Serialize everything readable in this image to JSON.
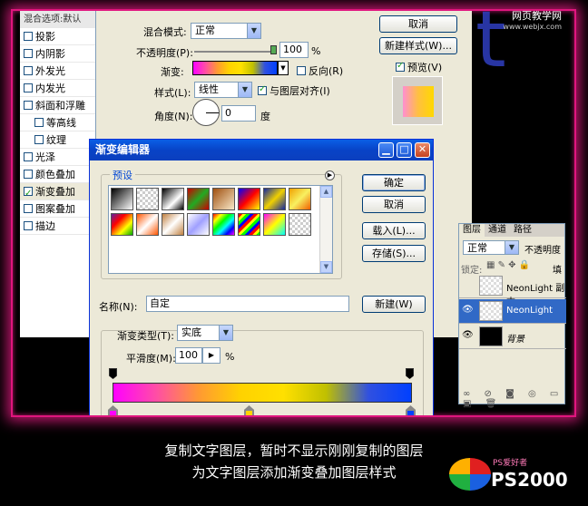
{
  "watermark": {
    "site": "网页教学网",
    "url": "www.webjx.com"
  },
  "style_list": {
    "header": "混合选项:默认",
    "items": [
      {
        "label": "投影",
        "checked": false
      },
      {
        "label": "内阴影",
        "checked": false
      },
      {
        "label": "外发光",
        "checked": false
      },
      {
        "label": "内发光",
        "checked": false
      },
      {
        "label": "斜面和浮雕",
        "checked": false
      },
      {
        "label": "等高线",
        "checked": false,
        "indent": true
      },
      {
        "label": "纹理",
        "checked": false,
        "indent": true
      },
      {
        "label": "光泽",
        "checked": false
      },
      {
        "label": "颜色叠加",
        "checked": false
      },
      {
        "label": "渐变叠加",
        "checked": true,
        "selected": true
      },
      {
        "label": "图案叠加",
        "checked": false
      },
      {
        "label": "描边",
        "checked": false
      }
    ]
  },
  "gradient_overlay": {
    "blend_mode_label": "混合模式:",
    "blend_mode": "正常",
    "opacity_label": "不透明度(P):",
    "opacity": "100",
    "opacity_unit": "%",
    "gradient_label": "渐变:",
    "reverse_label": "反向(R)",
    "style_label": "样式(L):",
    "style": "线性",
    "align_label": "与图层对齐(I)",
    "angle_label": "角度(N):",
    "angle": "0",
    "angle_unit": "度"
  },
  "style_buttons": {
    "cancel": "取消",
    "new_style": "新建样式(W)...",
    "preview": "预览(V)"
  },
  "layers_panel": {
    "tabs": [
      "图层",
      "通道",
      "路径"
    ],
    "mode": "正常",
    "opacity_label": "不透明度",
    "lock_label": "锁定:",
    "fill_label": "填",
    "layers": [
      {
        "name": "NeonLight 副本",
        "visible": false,
        "selected": false
      },
      {
        "name": "NeonLight",
        "visible": true,
        "selected": true
      },
      {
        "name": "背景",
        "visible": true,
        "selected": false
      }
    ]
  },
  "gradient_editor": {
    "title": "渐变编辑器",
    "presets_label": "预设",
    "ok": "确定",
    "cancel": "取消",
    "load": "载入(L)...",
    "save": "存储(S)...",
    "name_label": "名称(N):",
    "name_value": "自定",
    "new_button": "新建(W)",
    "type_label": "渐变类型(T):",
    "type_value": "实底",
    "smooth_label": "平滑度(M):",
    "smooth_value": "100",
    "smooth_unit": "%",
    "stop_colors": [
      "#ff00ff",
      "#ffd200",
      "#0040ff"
    ]
  },
  "caption": {
    "line1": "复制文字图层，暂时不显示刚刚复制的图层",
    "line2": "为文字图层添加渐变叠加图层样式"
  },
  "logo": {
    "text": "PS2000",
    "tag": "PS爱好者"
  }
}
